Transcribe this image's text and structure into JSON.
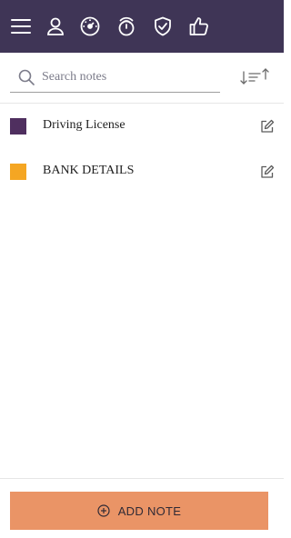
{
  "toolbar": {
    "bg_color": "#3f3556",
    "icons": [
      "menu-icon",
      "user-icon",
      "dashboard-icon",
      "timer-icon",
      "shield-icon",
      "thumbs-up-icon"
    ]
  },
  "search": {
    "placeholder": "Search notes",
    "value": "",
    "icon": "search-icon"
  },
  "sort": {
    "icon": "sort-icon"
  },
  "notes": [
    {
      "title": "Driving License",
      "color": "#4f2f5f",
      "edit_icon": "edit-icon"
    },
    {
      "title": "BANK DETAILS",
      "color": "#f5a623",
      "edit_icon": "edit-icon"
    }
  ],
  "add_button": {
    "label": "ADD NOTE",
    "icon": "plus-circle-icon",
    "color": "#ea9466"
  }
}
